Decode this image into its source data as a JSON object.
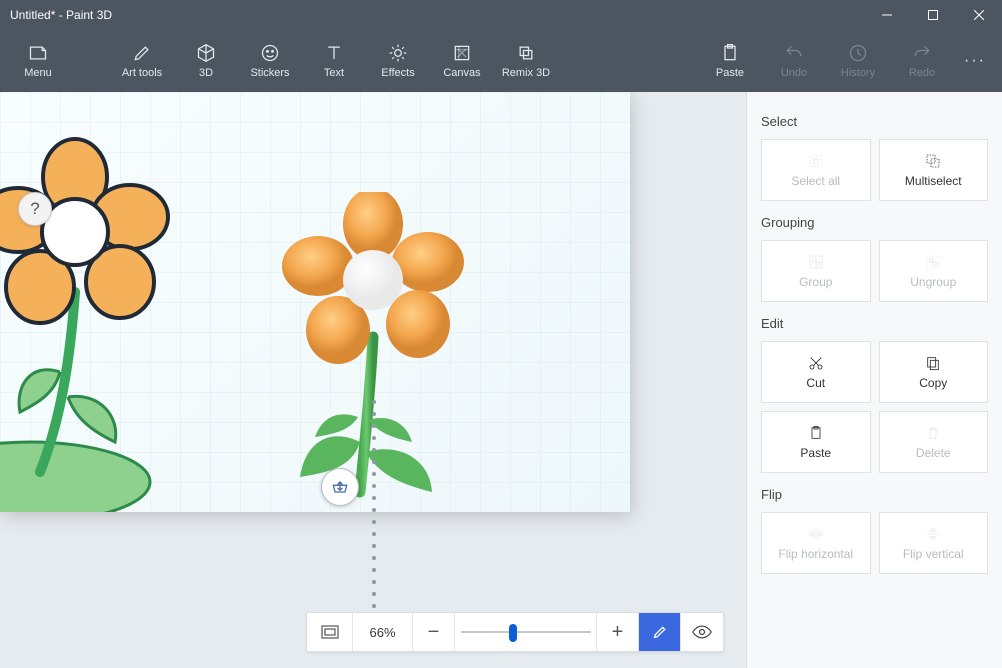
{
  "window": {
    "title": "Untitled* - Paint 3D"
  },
  "toolbar": {
    "menu": "Menu",
    "arttools": "Art tools",
    "threed": "3D",
    "stickers": "Stickers",
    "text": "Text",
    "effects": "Effects",
    "canvas": "Canvas",
    "remix3d": "Remix 3D",
    "paste": "Paste",
    "undo": "Undo",
    "history": "History",
    "redo": "Redo"
  },
  "zoom": {
    "percent": "66%"
  },
  "panel": {
    "select": {
      "label": "Select",
      "selectall": "Select all",
      "multiselect": "Multiselect"
    },
    "grouping": {
      "label": "Grouping",
      "group": "Group",
      "ungroup": "Ungroup"
    },
    "edit": {
      "label": "Edit",
      "cut": "Cut",
      "copy": "Copy",
      "paste": "Paste",
      "delete": "Delete"
    },
    "flip": {
      "label": "Flip",
      "horizontal": "Flip horizontal",
      "vertical": "Flip vertical"
    }
  },
  "help": "?"
}
